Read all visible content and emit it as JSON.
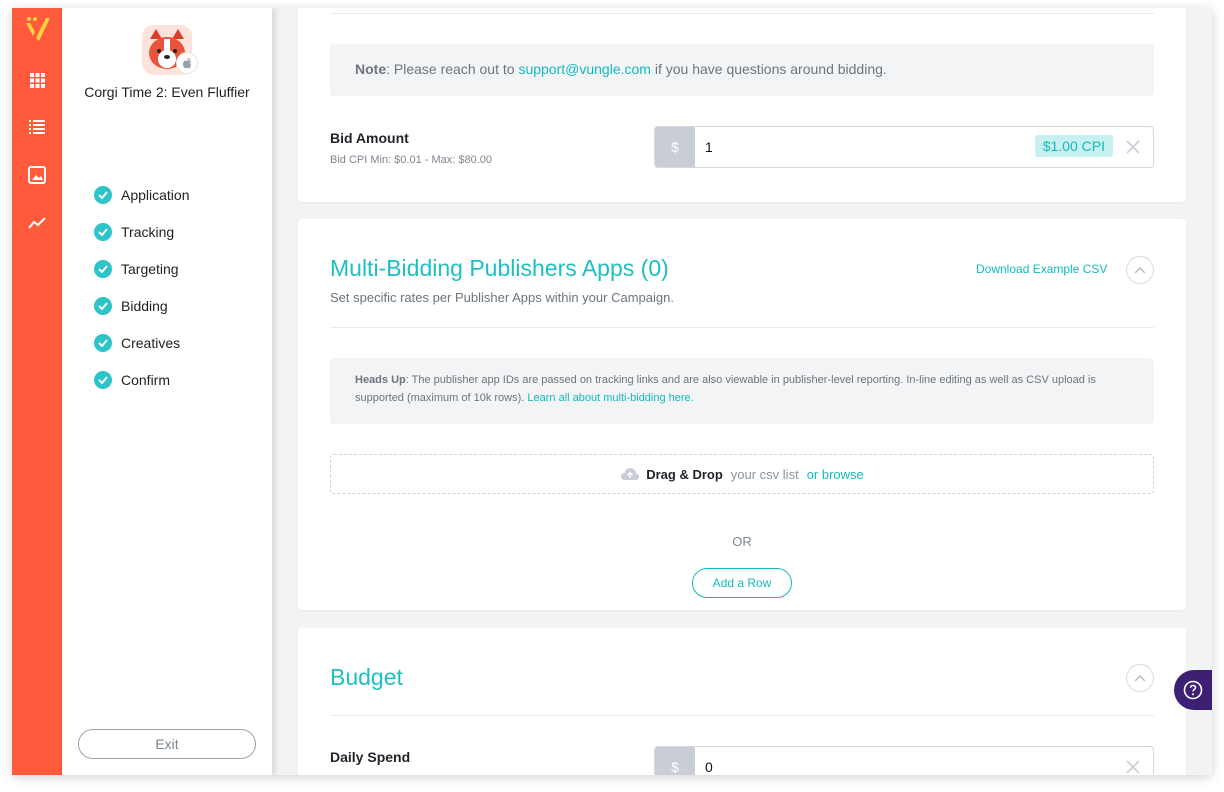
{
  "app": {
    "name": "Corgi Time 2: Even Fluffier",
    "platform_icon": "apple-icon"
  },
  "rail": {
    "icons": [
      "vungle-logo",
      "grid-icon",
      "list-icon",
      "image-icon",
      "chart-line-icon"
    ],
    "brand_color": "#ff5a3c"
  },
  "steps": [
    {
      "label": "Application",
      "status": "complete"
    },
    {
      "label": "Tracking",
      "status": "complete"
    },
    {
      "label": "Targeting",
      "status": "complete"
    },
    {
      "label": "Bidding",
      "status": "complete"
    },
    {
      "label": "Creatives",
      "status": "complete"
    },
    {
      "label": "Confirm",
      "status": "complete"
    }
  ],
  "exit_label": "Exit",
  "bidding": {
    "note_label": "Note",
    "note_pre": ": Please reach out to ",
    "note_email": "support@vungle.com",
    "note_post": " if you have questions around bidding.",
    "bid_label": "Bid Amount",
    "bid_hint": "Bid CPI Min: $0.01 - Max: $80.00",
    "currency": "$",
    "bid_value": "1",
    "bid_badge": "$1.00 CPI"
  },
  "multi_bidding": {
    "title": "Multi-Bidding Publishers Apps (0)",
    "subtitle": "Set specific rates per Publisher Apps within your Campaign.",
    "download_link": "Download Example CSV",
    "heads_up_label": "Heads Up",
    "heads_up_text": ": The publisher app IDs are passed on tracking links and are also viewable in publisher-level reporting. In-line editing as well as CSV upload is supported (maximum of 10k rows).",
    "learn_link": "Learn all about multi-bidding here.",
    "dropzone_strong": "Drag & Drop",
    "dropzone_text": "your csv list",
    "dropzone_link": "or browse",
    "or_label": "OR",
    "add_row_label": "Add a Row"
  },
  "budget": {
    "title": "Budget",
    "daily_spend_label": "Daily Spend",
    "currency": "$",
    "daily_spend_value": "0"
  },
  "colors": {
    "accent": "#1cc0c4",
    "help": "#3d1f74"
  }
}
